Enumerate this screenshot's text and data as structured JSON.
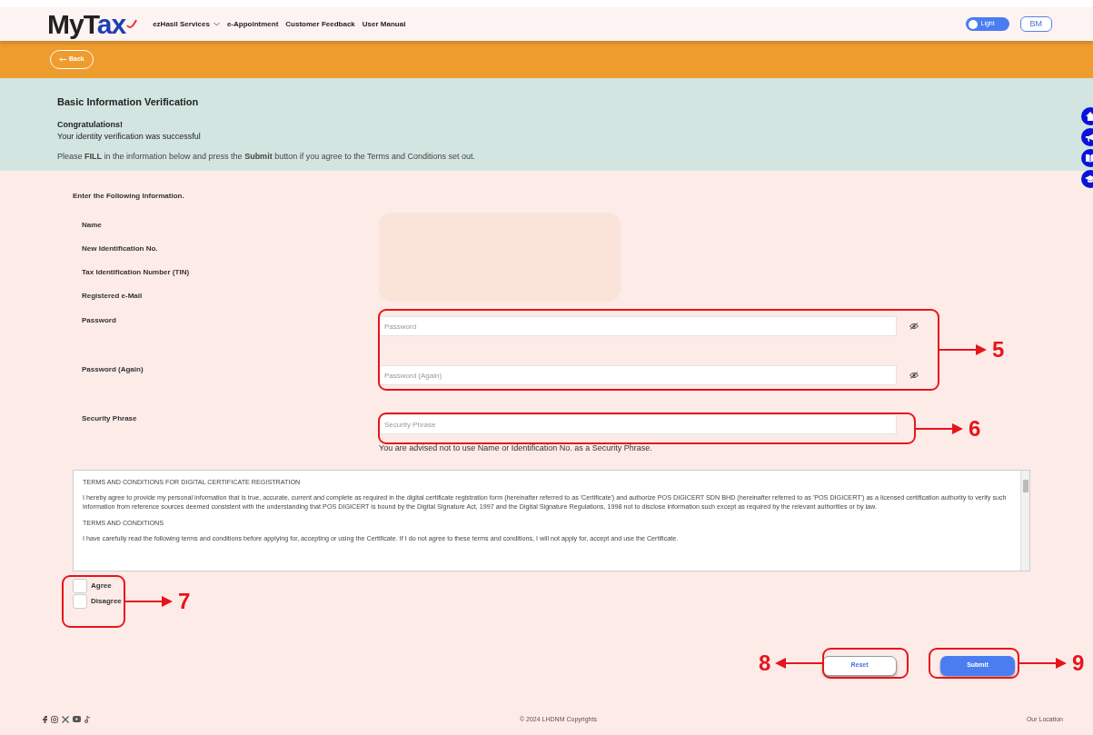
{
  "header": {
    "logo": "MyTax",
    "nav": [
      {
        "label": "ezHasil Services",
        "dropdown": true
      },
      {
        "label": "e-Appointment",
        "dropdown": false
      },
      {
        "label": "Customer Feedback",
        "dropdown": false
      },
      {
        "label": "User Manual",
        "dropdown": false
      }
    ],
    "theme_toggle": {
      "label": "Light"
    },
    "language_button": "BM"
  },
  "back_button": "Back",
  "intro": {
    "title": "Basic Information Verification",
    "heading": "Congratulations!",
    "message": "Your identity verification was successful",
    "instruction": "Please **FILL** in the information below and press the **Submit** button if you agree to the Terms and Conditions set out."
  },
  "form": {
    "caption": "Enter the Following Information.",
    "info_labels": [
      "Name",
      "New Identification No.",
      "Tax Identification Number (TIN)",
      "Registered e-Mail"
    ],
    "fields": [
      {
        "label": "Password",
        "placeholder": "Password",
        "kind": "password"
      },
      {
        "label": "Password (Again)",
        "placeholder": "Password (Again)",
        "kind": "password"
      },
      {
        "label": "Security Phrase",
        "placeholder": "Security Phrase",
        "kind": "text",
        "hint": "You are advised not to use Name or Identification No. as a Security Phrase."
      }
    ]
  },
  "terms": [
    "TERMS AND CONDITIONS FOR DIGITAL CERTIFICATE REGISTRATION",
    "I hereby agree to provide my personal information that is true, accurate, current and complete as required in the digital certificate registration form (hereinafter referred to as 'Certificate') and authorize POS DIGICERT SDN BHD (hereinafter referred to as 'POS DIGICERT') as a licensed certification authority to verify such information from reference sources deemed consistent with the understanding that POS DIGICERT is bound by the Digital Signature Act, 1997 and the Digital Signature Regulations, 1998 not to disclose information such except as required by the relevant authorities or by law.",
    "TERMS AND CONDITIONS",
    "I have carefully read the following terms and conditions before applying for, accepting or using the Certificate. If I do not agree to these terms and conditions, I will not apply for, accept and use the Certificate."
  ],
  "consent": [
    {
      "label": "Agree",
      "checked": false
    },
    {
      "label": "Disagree",
      "checked": false
    }
  ],
  "buttons": [
    {
      "label": "Reset",
      "kind": "secondary"
    },
    {
      "label": "Submit",
      "kind": "primary"
    }
  ],
  "footer": {
    "copyright": "© 2024 LHDNM Copyrights",
    "location_link": "Our Location"
  },
  "annotations": [
    {
      "number": "5",
      "arrow_left": false
    },
    {
      "number": "6",
      "arrow_left": false
    },
    {
      "number": "7",
      "arrow_left": false
    },
    {
      "number": "8",
      "arrow_left": true
    },
    {
      "number": "9",
      "arrow_left": false
    }
  ]
}
